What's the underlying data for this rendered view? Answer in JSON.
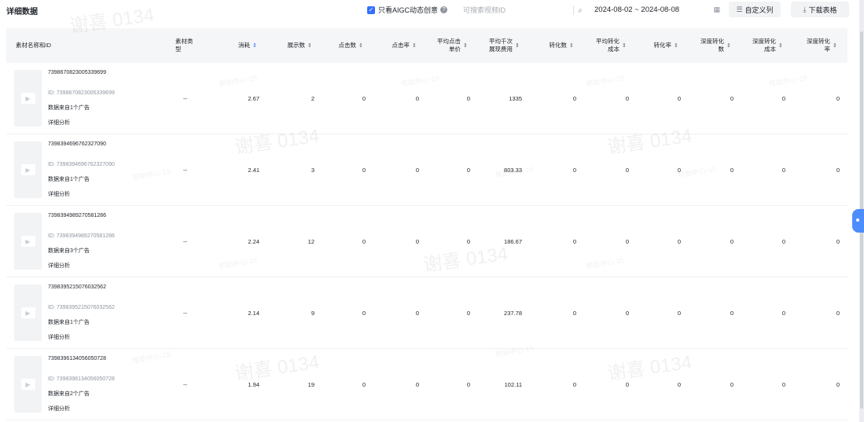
{
  "page": {
    "title": "详细数据"
  },
  "filters": {
    "aigc_label": "只看AIGC动态创意",
    "aigc_checked": true,
    "search_placeholder": "可搜索视频ID",
    "date_range": "2024-08-02 ~ 2024-08-08"
  },
  "buttons": {
    "custom_columns": "自定义列",
    "download": "下载表格"
  },
  "icons": {
    "checkbox": "checkbox-checked-icon",
    "help": "question-circle-icon",
    "search": "search-icon",
    "calendar": "calendar-icon",
    "columns": "columns-icon",
    "download": "download-icon",
    "play": "play-icon",
    "sort": "sort-icon",
    "assistant": "assistant-mascot-icon"
  },
  "colors": {
    "accent": "#3370ff",
    "header_bg": "#f5f6f7",
    "thumb_bg": "#f2f3f5"
  },
  "table": {
    "columns": [
      {
        "label": "素材名称和ID",
        "sortable": false
      },
      {
        "label": "素材类型",
        "sortable": false
      },
      {
        "label": "消耗",
        "sortable": true,
        "active": true
      },
      {
        "label": "展示数",
        "sortable": true
      },
      {
        "label": "点击数",
        "sortable": true
      },
      {
        "label": "点击率",
        "sortable": true
      },
      {
        "label": "平均点击 单价",
        "sortable": true
      },
      {
        "label": "平均千次 展现费用",
        "sortable": true
      },
      {
        "label": "转化数",
        "sortable": true
      },
      {
        "label": "平均转化 成本",
        "sortable": true
      },
      {
        "label": "转化率",
        "sortable": true
      },
      {
        "label": "深度转化 数",
        "sortable": true
      },
      {
        "label": "深度转化 成本",
        "sortable": true
      },
      {
        "label": "深度转化 率",
        "sortable": true
      }
    ],
    "rows": [
      {
        "name": "7398670823005339699",
        "id": "ID: 7398670823005339699",
        "source": "数据来自1个广告",
        "detail": "详细分析",
        "type": "--",
        "cost": "2.67",
        "impressions": "2",
        "clicks": "0",
        "ctr": "0",
        "cpc": "0",
        "cpm": "1335",
        "conversions": "0",
        "cpa": "0",
        "cvr": "0",
        "deep_conv": "0",
        "deep_cost": "0",
        "deep_rate": "0"
      },
      {
        "name": "7398394696762327090",
        "id": "ID: 7398394696762327090",
        "source": "数据来自1个广告",
        "detail": "详细分析",
        "type": "--",
        "cost": "2.41",
        "impressions": "3",
        "clicks": "0",
        "ctr": "0",
        "cpc": "0",
        "cpm": "803.33",
        "conversions": "0",
        "cpa": "0",
        "cvr": "0",
        "deep_conv": "0",
        "deep_cost": "0",
        "deep_rate": "0"
      },
      {
        "name": "7398394989270581286",
        "id": "ID: 7398394989270581286",
        "source": "数据来自3个广告",
        "detail": "详细分析",
        "type": "--",
        "cost": "2.24",
        "impressions": "12",
        "clicks": "0",
        "ctr": "0",
        "cpc": "0",
        "cpm": "186.67",
        "conversions": "0",
        "cpa": "0",
        "cvr": "0",
        "deep_conv": "0",
        "deep_cost": "0",
        "deep_rate": "0"
      },
      {
        "name": "7398395215076032562",
        "id": "ID: 7398395215076032562",
        "source": "数据来自1个广告",
        "detail": "详细分析",
        "type": "--",
        "cost": "2.14",
        "impressions": "9",
        "clicks": "0",
        "ctr": "0",
        "cpc": "0",
        "cpm": "237.78",
        "conversions": "0",
        "cpa": "0",
        "cvr": "0",
        "deep_conv": "0",
        "deep_cost": "0",
        "deep_rate": "0"
      },
      {
        "name": "7398396134056050728",
        "id": "ID: 7398396134056050728",
        "source": "数据来自2个广告",
        "detail": "详细分析",
        "type": "--",
        "cost": "1.94",
        "impressions": "19",
        "clicks": "0",
        "ctr": "0",
        "cpc": "0",
        "cpm": "102.11",
        "conversions": "0",
        "cpa": "0",
        "cvr": "0",
        "deep_conv": "0",
        "deep_cost": "0",
        "deep_rate": "0"
      }
    ]
  },
  "watermarks": {
    "name": "谢喜 0134",
    "helpdesk": "帮助中心-15"
  }
}
